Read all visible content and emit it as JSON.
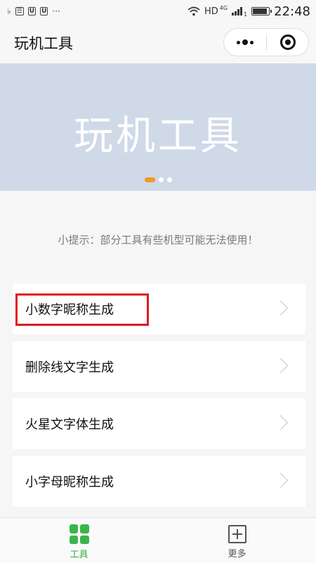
{
  "status_bar": {
    "network": "HD",
    "network_gen": "4G",
    "sim_slot": "1",
    "overflow": "···",
    "time": "22:48"
  },
  "nav": {
    "title": "玩机工具"
  },
  "banner": {
    "text": "玩机工具",
    "slides": 3,
    "active_slide": 1
  },
  "tip": "小提示：部分工具有些机型可能无法使用！",
  "tools": [
    "小数字昵称生成",
    "删除线文字生成",
    "火星文字体生成",
    "小字母昵称生成"
  ],
  "tab_bar": {
    "tabs": [
      {
        "label": "工具",
        "icon": "grid-icon",
        "active": true
      },
      {
        "label": "更多",
        "icon": "plus-square-icon",
        "active": false
      }
    ]
  },
  "colors": {
    "accent_green": "#3ab54a",
    "banner_bg": "#cfd9e8",
    "active_dot": "#f39a1e",
    "highlight_red": "#e0191f"
  }
}
